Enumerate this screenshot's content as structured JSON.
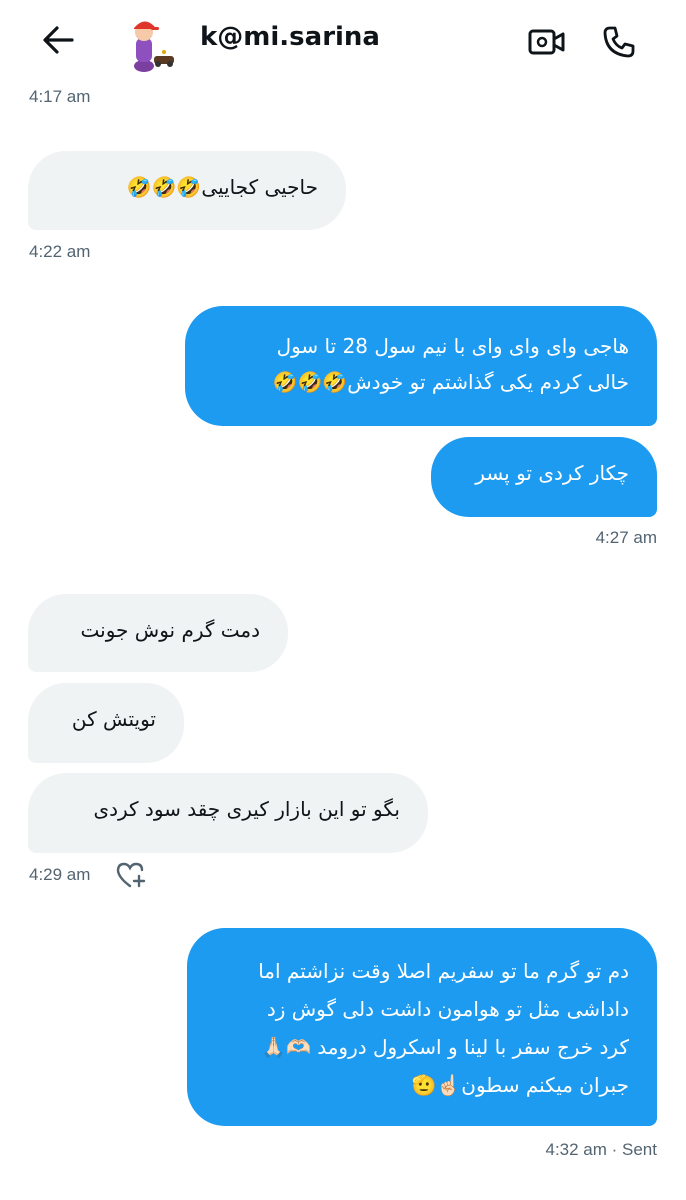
{
  "header": {
    "title": "k@mi.sarina",
    "back_label": "Back",
    "video_label": "Video call",
    "call_label": "Voice call"
  },
  "colors": {
    "outgoing_bubble": "#1d9bf0",
    "incoming_bubble": "#eff3f4",
    "timestamp": "#536471"
  },
  "messages": {
    "ts0": "4:17 am",
    "m1": {
      "text": "حاجیی کجاییی🤣🤣🤣"
    },
    "ts1": "4:22 am",
    "m2": {
      "lines": [
        "هاجی وای وای وای با نیم سول 28 تا سول",
        "خالی کردم یکی گذاشتم تو خودش🤣🤣🤣"
      ]
    },
    "m3": {
      "text": "چکار کردی تو پسر"
    },
    "ts2": "4:27 am",
    "m4": {
      "text": "دمت گرم نوش جونت"
    },
    "m5": {
      "text": "تویتش کن"
    },
    "m6": {
      "text": "بگو تو این بازار کیری چقد سود کردی"
    },
    "ts3": "4:29 am",
    "m7": {
      "lines": [
        "دم تو گرم ما تو سفریم اصلا وقت نزاشتم اما",
        "داداشی مثل تو هوامون داشت دلی  گوش زد",
        "کرد خرج سفر با لینا و اسکرول درومد 🫶🏻🙏🏻",
        "جبران میکنم سطون☝🏻🫡"
      ]
    },
    "ts4": "4:32 am · Sent"
  },
  "icons": {
    "back": "arrow-left-icon",
    "video": "video-camera-icon",
    "phone": "phone-icon",
    "react": "heart-plus-icon"
  }
}
